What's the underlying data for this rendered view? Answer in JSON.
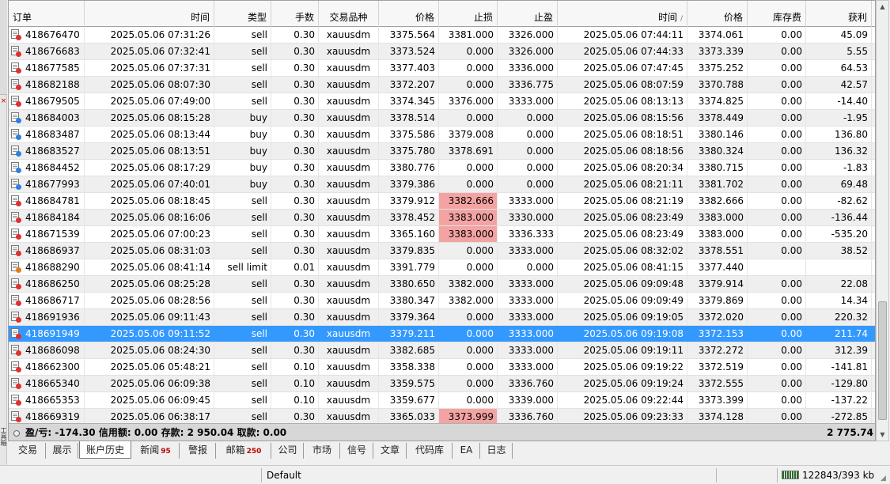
{
  "columns": [
    "订单",
    "时间",
    "类型",
    "手数",
    "交易品种",
    "价格",
    "止损",
    "止盈",
    "时间",
    "价格",
    "库存费",
    "获利"
  ],
  "sort_indicator": "/",
  "side_label": "工具箱",
  "rows": [
    {
      "order": "418676470",
      "open_time": "2025.05.06 07:31:26",
      "type": "sell",
      "lots": "0.30",
      "symbol": "xauusdm",
      "open_price": "3375.564",
      "sl": "3381.000",
      "tp": "3326.000",
      "close_time": "2025.05.06 07:44:11",
      "close_price": "3374.061",
      "swap": "0.00",
      "profit": "45.09",
      "kind": "sell",
      "sl_hl": false
    },
    {
      "order": "418676683",
      "open_time": "2025.05.06 07:32:41",
      "type": "sell",
      "lots": "0.30",
      "symbol": "xauusdm",
      "open_price": "3373.524",
      "sl": "0.000",
      "tp": "3326.000",
      "close_time": "2025.05.06 07:44:33",
      "close_price": "3373.339",
      "swap": "0.00",
      "profit": "5.55",
      "kind": "sell",
      "sl_hl": false
    },
    {
      "order": "418677585",
      "open_time": "2025.05.06 07:37:31",
      "type": "sell",
      "lots": "0.30",
      "symbol": "xauusdm",
      "open_price": "3377.403",
      "sl": "0.000",
      "tp": "3336.000",
      "close_time": "2025.05.06 07:47:45",
      "close_price": "3375.252",
      "swap": "0.00",
      "profit": "64.53",
      "kind": "sell",
      "sl_hl": false
    },
    {
      "order": "418682188",
      "open_time": "2025.05.06 08:07:30",
      "type": "sell",
      "lots": "0.30",
      "symbol": "xauusdm",
      "open_price": "3372.207",
      "sl": "0.000",
      "tp": "3336.775",
      "close_time": "2025.05.06 08:07:59",
      "close_price": "3370.788",
      "swap": "0.00",
      "profit": "42.57",
      "kind": "sell",
      "sl_hl": false
    },
    {
      "order": "418679505",
      "open_time": "2025.05.06 07:49:00",
      "type": "sell",
      "lots": "0.30",
      "symbol": "xauusdm",
      "open_price": "3374.345",
      "sl": "3376.000",
      "tp": "3333.000",
      "close_time": "2025.05.06 08:13:13",
      "close_price": "3374.825",
      "swap": "0.00",
      "profit": "-14.40",
      "kind": "sell",
      "sl_hl": false
    },
    {
      "order": "418684003",
      "open_time": "2025.05.06 08:15:28",
      "type": "buy",
      "lots": "0.30",
      "symbol": "xauusdm",
      "open_price": "3378.514",
      "sl": "0.000",
      "tp": "0.000",
      "close_time": "2025.05.06 08:15:56",
      "close_price": "3378.449",
      "swap": "0.00",
      "profit": "-1.95",
      "kind": "buy",
      "sl_hl": false
    },
    {
      "order": "418683487",
      "open_time": "2025.05.06 08:13:44",
      "type": "buy",
      "lots": "0.30",
      "symbol": "xauusdm",
      "open_price": "3375.586",
      "sl": "3379.008",
      "tp": "0.000",
      "close_time": "2025.05.06 08:18:51",
      "close_price": "3380.146",
      "swap": "0.00",
      "profit": "136.80",
      "kind": "buy",
      "sl_hl": false
    },
    {
      "order": "418683527",
      "open_time": "2025.05.06 08:13:51",
      "type": "buy",
      "lots": "0.30",
      "symbol": "xauusdm",
      "open_price": "3375.780",
      "sl": "3378.691",
      "tp": "0.000",
      "close_time": "2025.05.06 08:18:56",
      "close_price": "3380.324",
      "swap": "0.00",
      "profit": "136.32",
      "kind": "buy",
      "sl_hl": false
    },
    {
      "order": "418684452",
      "open_time": "2025.05.06 08:17:29",
      "type": "buy",
      "lots": "0.30",
      "symbol": "xauusdm",
      "open_price": "3380.776",
      "sl": "0.000",
      "tp": "0.000",
      "close_time": "2025.05.06 08:20:34",
      "close_price": "3380.715",
      "swap": "0.00",
      "profit": "-1.83",
      "kind": "buy",
      "sl_hl": false
    },
    {
      "order": "418677993",
      "open_time": "2025.05.06 07:40:01",
      "type": "buy",
      "lots": "0.30",
      "symbol": "xauusdm",
      "open_price": "3379.386",
      "sl": "0.000",
      "tp": "0.000",
      "close_time": "2025.05.06 08:21:11",
      "close_price": "3381.702",
      "swap": "0.00",
      "profit": "69.48",
      "kind": "buy",
      "sl_hl": false
    },
    {
      "order": "418684781",
      "open_time": "2025.05.06 08:18:45",
      "type": "sell",
      "lots": "0.30",
      "symbol": "xauusdm",
      "open_price": "3379.912",
      "sl": "3382.666",
      "tp": "3333.000",
      "close_time": "2025.05.06 08:21:19",
      "close_price": "3382.666",
      "swap": "0.00",
      "profit": "-82.62",
      "kind": "sell",
      "sl_hl": true
    },
    {
      "order": "418684184",
      "open_time": "2025.05.06 08:16:06",
      "type": "sell",
      "lots": "0.30",
      "symbol": "xauusdm",
      "open_price": "3378.452",
      "sl": "3383.000",
      "tp": "3330.000",
      "close_time": "2025.05.06 08:23:49",
      "close_price": "3383.000",
      "swap": "0.00",
      "profit": "-136.44",
      "kind": "sell",
      "sl_hl": true
    },
    {
      "order": "418671539",
      "open_time": "2025.05.06 07:00:23",
      "type": "sell",
      "lots": "0.30",
      "symbol": "xauusdm",
      "open_price": "3365.160",
      "sl": "3383.000",
      "tp": "3336.333",
      "close_time": "2025.05.06 08:23:49",
      "close_price": "3383.000",
      "swap": "0.00",
      "profit": "-535.20",
      "kind": "sell",
      "sl_hl": true
    },
    {
      "order": "418686937",
      "open_time": "2025.05.06 08:31:03",
      "type": "sell",
      "lots": "0.30",
      "symbol": "xauusdm",
      "open_price": "3379.835",
      "sl": "0.000",
      "tp": "3333.000",
      "close_time": "2025.05.06 08:32:02",
      "close_price": "3378.551",
      "swap": "0.00",
      "profit": "38.52",
      "kind": "sell",
      "sl_hl": false
    },
    {
      "order": "418688290",
      "open_time": "2025.05.06 08:41:14",
      "type": "sell limit",
      "lots": "0.01",
      "symbol": "xauusdm",
      "open_price": "3391.779",
      "sl": "0.000",
      "tp": "0.000",
      "close_time": "2025.05.06 08:41:15",
      "close_price": "3377.440",
      "swap": "",
      "profit": "",
      "kind": "pend",
      "sl_hl": false
    },
    {
      "order": "418686250",
      "open_time": "2025.05.06 08:25:28",
      "type": "sell",
      "lots": "0.30",
      "symbol": "xauusdm",
      "open_price": "3380.650",
      "sl": "3382.000",
      "tp": "3333.000",
      "close_time": "2025.05.06 09:09:48",
      "close_price": "3379.914",
      "swap": "0.00",
      "profit": "22.08",
      "kind": "sell",
      "sl_hl": false
    },
    {
      "order": "418686717",
      "open_time": "2025.05.06 08:28:56",
      "type": "sell",
      "lots": "0.30",
      "symbol": "xauusdm",
      "open_price": "3380.347",
      "sl": "3382.000",
      "tp": "3333.000",
      "close_time": "2025.05.06 09:09:49",
      "close_price": "3379.869",
      "swap": "0.00",
      "profit": "14.34",
      "kind": "sell",
      "sl_hl": false
    },
    {
      "order": "418691936",
      "open_time": "2025.05.06 09:11:43",
      "type": "sell",
      "lots": "0.30",
      "symbol": "xauusdm",
      "open_price": "3379.364",
      "sl": "0.000",
      "tp": "3333.000",
      "close_time": "2025.05.06 09:19:05",
      "close_price": "3372.020",
      "swap": "0.00",
      "profit": "220.32",
      "kind": "sell",
      "sl_hl": false
    },
    {
      "order": "418691949",
      "open_time": "2025.05.06 09:11:52",
      "type": "sell",
      "lots": "0.30",
      "symbol": "xauusdm",
      "open_price": "3379.211",
      "sl": "0.000",
      "tp": "3333.000",
      "close_time": "2025.05.06 09:19:08",
      "close_price": "3372.153",
      "swap": "0.00",
      "profit": "211.74",
      "kind": "sell",
      "sl_hl": false,
      "selected": true
    },
    {
      "order": "418686098",
      "open_time": "2025.05.06 08:24:30",
      "type": "sell",
      "lots": "0.30",
      "symbol": "xauusdm",
      "open_price": "3382.685",
      "sl": "0.000",
      "tp": "3333.000",
      "close_time": "2025.05.06 09:19:11",
      "close_price": "3372.272",
      "swap": "0.00",
      "profit": "312.39",
      "kind": "sell",
      "sl_hl": false
    },
    {
      "order": "418662300",
      "open_time": "2025.05.06 05:48:21",
      "type": "sell",
      "lots": "0.10",
      "symbol": "xauusdm",
      "open_price": "3358.338",
      "sl": "0.000",
      "tp": "3333.000",
      "close_time": "2025.05.06 09:19:22",
      "close_price": "3372.519",
      "swap": "0.00",
      "profit": "-141.81",
      "kind": "sell",
      "sl_hl": false
    },
    {
      "order": "418665340",
      "open_time": "2025.05.06 06:09:38",
      "type": "sell",
      "lots": "0.10",
      "symbol": "xauusdm",
      "open_price": "3359.575",
      "sl": "0.000",
      "tp": "3336.760",
      "close_time": "2025.05.06 09:19:24",
      "close_price": "3372.555",
      "swap": "0.00",
      "profit": "-129.80",
      "kind": "sell",
      "sl_hl": false
    },
    {
      "order": "418665353",
      "open_time": "2025.05.06 06:09:45",
      "type": "sell",
      "lots": "0.10",
      "symbol": "xauusdm",
      "open_price": "3359.677",
      "sl": "0.000",
      "tp": "3339.000",
      "close_time": "2025.05.06 09:22:44",
      "close_price": "3373.399",
      "swap": "0.00",
      "profit": "-137.22",
      "kind": "sell",
      "sl_hl": false
    },
    {
      "order": "418669319",
      "open_time": "2025.05.06 06:38:17",
      "type": "sell",
      "lots": "0.30",
      "symbol": "xauusdm",
      "open_price": "3365.033",
      "sl": "3373.999",
      "tp": "3336.760",
      "close_time": "2025.05.06 09:23:33",
      "close_price": "3374.128",
      "swap": "0.00",
      "profit": "-272.85",
      "kind": "sell",
      "sl_hl": true
    }
  ],
  "summary": {
    "text": "盈/亏: -174.30  信用额: 0.00  存款: 2 950.04  取款: 0.00",
    "total": "2 775.74"
  },
  "tabs": [
    {
      "label": "交易",
      "badge": "",
      "active": false
    },
    {
      "label": "展示",
      "badge": "",
      "active": false
    },
    {
      "label": "账户历史",
      "badge": "",
      "active": true
    },
    {
      "label": "新闻",
      "badge": "95",
      "active": false
    },
    {
      "label": "警报",
      "badge": "",
      "active": false
    },
    {
      "label": "邮箱",
      "badge": "250",
      "active": false
    },
    {
      "label": "公司",
      "badge": "",
      "active": false
    },
    {
      "label": "市场",
      "badge": "",
      "active": false
    },
    {
      "label": "信号",
      "badge": "",
      "active": false
    },
    {
      "label": "文章",
      "badge": "",
      "active": false
    },
    {
      "label": "代码库",
      "badge": "",
      "active": false
    },
    {
      "label": "EA",
      "badge": "",
      "active": false
    },
    {
      "label": "日志",
      "badge": "",
      "active": false
    }
  ],
  "status": {
    "profile": "Default",
    "memory": "122843/393 kb"
  },
  "colors": {
    "selected_row": "#3399ff",
    "sl_highlight": "#f4a3a3",
    "badge": "#c00000",
    "sell_icon_dot": "#e03030",
    "buy_icon_dot": "#2f7fe0"
  }
}
